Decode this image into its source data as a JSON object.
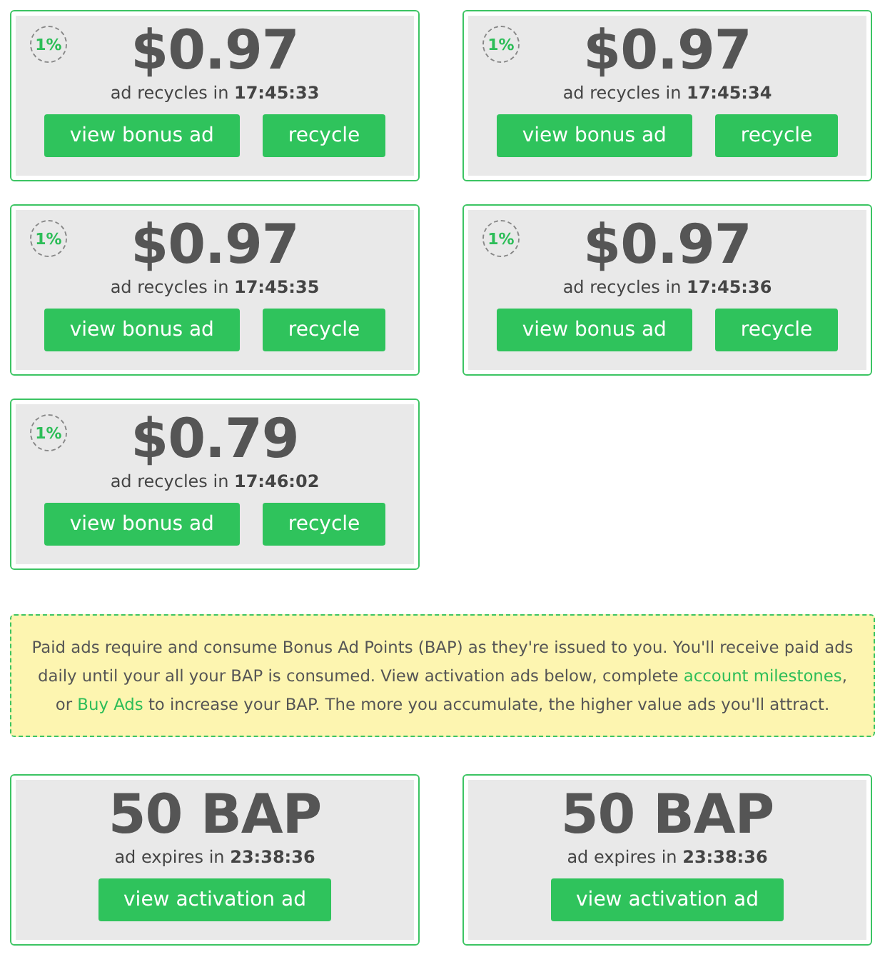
{
  "bonus_ads": [
    {
      "badge": "1%",
      "amount": "$0.97",
      "countdown": "ad recycles in **17:45:33**",
      "buttons": [
        "view bonus ad",
        "recycle"
      ]
    },
    {
      "badge": "1%",
      "amount": "$0.97",
      "countdown": "ad recycles in **17:45:34**",
      "buttons": [
        "view bonus ad",
        "recycle"
      ]
    },
    {
      "badge": "1%",
      "amount": "$0.97",
      "countdown": "ad recycles in **17:45:35**",
      "buttons": [
        "view bonus ad",
        "recycle"
      ]
    },
    {
      "badge": "1%",
      "amount": "$0.97",
      "countdown": "ad recycles in **17:45:36**",
      "buttons": [
        "view bonus ad",
        "recycle"
      ]
    },
    {
      "badge": "1%",
      "amount": "$0.79",
      "countdown": "ad recycles in **17:46:02**",
      "buttons": [
        "view bonus ad",
        "recycle"
      ]
    }
  ],
  "notice": {
    "parts": [
      {
        "kind": "text",
        "text": "Paid ads require and consume Bonus Ad Points (BAP) as they're issued to you. You'll receive paid ads daily until your all your BAP is consumed. View activation ads below, complete "
      },
      {
        "kind": "link",
        "text": "account milestones"
      },
      {
        "kind": "text",
        "text": ", or "
      },
      {
        "kind": "link",
        "text": "Buy Ads"
      },
      {
        "kind": "text",
        "text": " to increase your BAP. The more you accumulate, the higher value ads you'll attract."
      }
    ]
  },
  "activation_ads": [
    {
      "amount": "50 BAP",
      "countdown": "ad expires in **23:38:36**",
      "buttons": [
        "view activation ad"
      ]
    },
    {
      "amount": "50 BAP",
      "countdown": "ad expires in **23:38:36**",
      "buttons": [
        "view activation ad"
      ]
    }
  ]
}
